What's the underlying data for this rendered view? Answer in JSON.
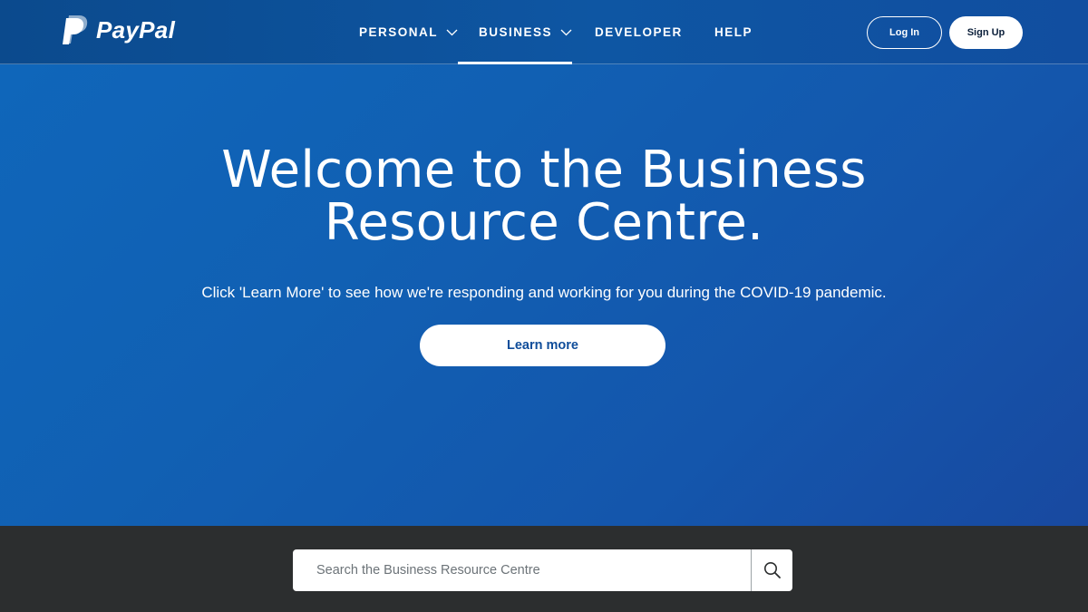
{
  "brand": {
    "name": "PayPal"
  },
  "nav": {
    "items": [
      {
        "label": "PERSONAL",
        "has_dropdown": true
      },
      {
        "label": "BUSINESS",
        "has_dropdown": true,
        "active": true
      },
      {
        "label": "DEVELOPER",
        "has_dropdown": false
      },
      {
        "label": "HELP",
        "has_dropdown": false
      }
    ]
  },
  "auth": {
    "login_label": "Log In",
    "signup_label": "Sign Up"
  },
  "hero": {
    "title_line1": "Welcome to the Business",
    "title_line2": "Resource Centre.",
    "subtitle": "Click 'Learn More' to see how we're responding and working for you during the COVID-19 pandemic.",
    "cta_label": "Learn more"
  },
  "search": {
    "placeholder": "Search the Business Resource Centre",
    "value": "",
    "icon": "search-icon"
  },
  "colors": {
    "header_bg": "#0e56a3",
    "hero_bg": "#1160b3",
    "search_band_bg": "#2c2e2f",
    "cta_text": "#0f4d9a"
  }
}
